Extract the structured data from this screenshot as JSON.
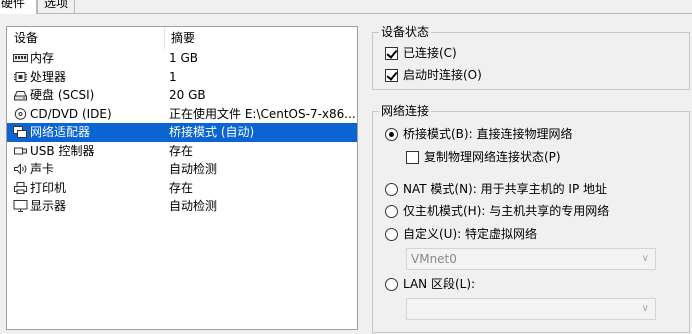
{
  "tabs": [
    {
      "label": "硬件",
      "active": true
    },
    {
      "label": "选项",
      "active": false
    }
  ],
  "device_list": {
    "col_device": "设备",
    "col_summary": "摘要",
    "rows": [
      {
        "icon": "memory-icon",
        "name": "内存",
        "summary": "1 GB"
      },
      {
        "icon": "processor-icon",
        "name": "处理器",
        "summary": "1"
      },
      {
        "icon": "hard-disk-icon",
        "name": "硬盘 (SCSI)",
        "summary": "20 GB"
      },
      {
        "icon": "cd-dvd-icon",
        "name": "CD/DVD (IDE)",
        "summary": "正在使用文件 E:\\CentOS-7-x86..."
      },
      {
        "icon": "network-adapter-icon",
        "name": "网络适配器",
        "summary": "桥接模式 (自动)",
        "selected": true
      },
      {
        "icon": "usb-icon",
        "name": "USB 控制器",
        "summary": "存在"
      },
      {
        "icon": "sound-card-icon",
        "name": "声卡",
        "summary": "自动检测"
      },
      {
        "icon": "printer-icon",
        "name": "打印机",
        "summary": "存在"
      },
      {
        "icon": "display-icon",
        "name": "显示器",
        "summary": "自动检测"
      }
    ]
  },
  "device_status": {
    "title": "设备状态",
    "connected": {
      "label": "已连接(C)",
      "checked": true
    },
    "connect_on_power": {
      "label": "启动时连接(O)",
      "checked": true
    }
  },
  "network": {
    "title": "网络连接",
    "bridged": {
      "label": "桥接模式(B): 直接连接物理网络",
      "selected": true
    },
    "replicate": {
      "label": "复制物理网络连接状态(P)",
      "checked": false
    },
    "nat": {
      "label": "NAT 模式(N): 用于共享主机的 IP 地址",
      "selected": false
    },
    "host_only": {
      "label": "仅主机模式(H): 与主机共享的专用网络",
      "selected": false
    },
    "custom": {
      "label": "自定义(U): 特定虚拟网络",
      "selected": false
    },
    "custom_combo_value": "VMnet0",
    "lan": {
      "label": "LAN 区段(L):",
      "selected": false
    },
    "lan_combo_value": ""
  },
  "colors": {
    "selection": "#0a64d2",
    "background": "#f0f0f0"
  }
}
